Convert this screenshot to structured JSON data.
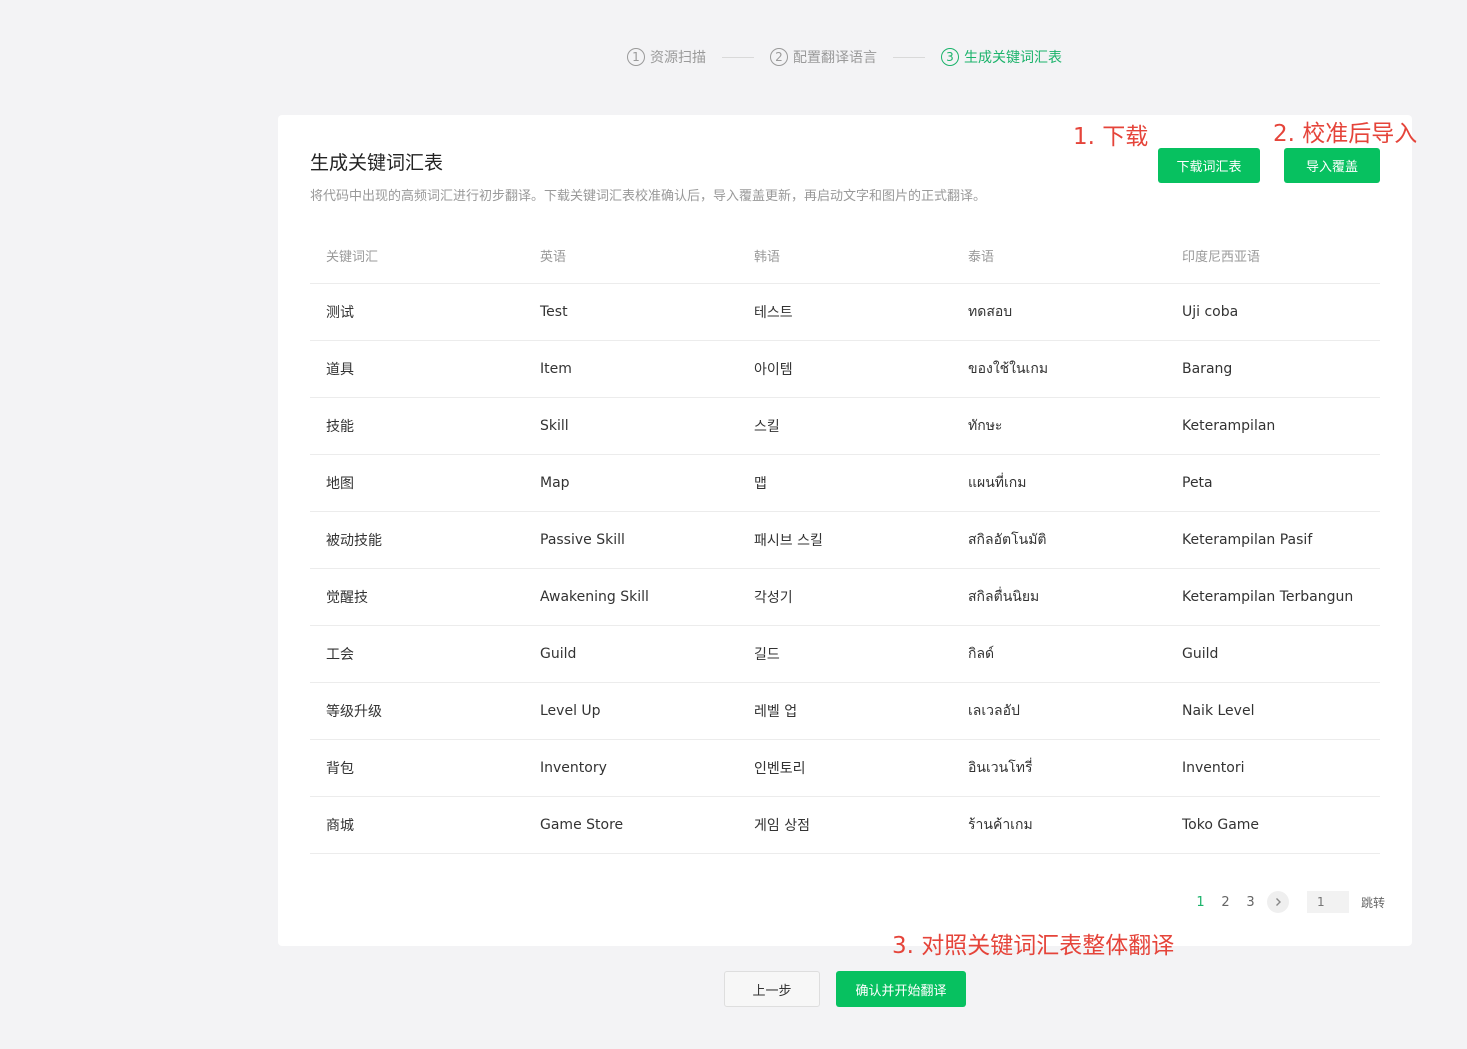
{
  "steps": [
    {
      "num": "1",
      "label": "资源扫描",
      "active": false
    },
    {
      "num": "2",
      "label": "配置翻译语言",
      "active": false
    },
    {
      "num": "3",
      "label": "生成关键词汇表",
      "active": true
    }
  ],
  "card": {
    "title": "生成关键词汇表",
    "description": "将代码中出现的高频词汇进行初步翻译。下载关键词汇表校准确认后，导入覆盖更新，再启动文字和图片的正式翻译。",
    "download_label": "下载词汇表",
    "import_label": "导入覆盖"
  },
  "annotations": {
    "a1": "1. 下载",
    "a2": "2. 校准后导入",
    "a3": "3. 对照关键词汇表整体翻译"
  },
  "table": {
    "headers": [
      "关键词汇",
      "英语",
      "韩语",
      "泰语",
      "印度尼西亚语"
    ],
    "rows": [
      [
        "测试",
        "Test",
        "테스트",
        "ทดสอบ",
        "Uji coba"
      ],
      [
        "道具",
        "Item",
        "아이템",
        "ของใช้ในเกม",
        "Barang"
      ],
      [
        "技能",
        "Skill",
        "스킬",
        "ทักษะ",
        "Keterampilan"
      ],
      [
        "地图",
        "Map",
        "맵",
        "แผนที่เกม",
        "Peta"
      ],
      [
        "被动技能",
        "Passive Skill",
        "패시브 스킬",
        "สกิลอัตโนมัติ",
        "Keterampilan Pasif"
      ],
      [
        "觉醒技",
        "Awakening Skill",
        "각성기",
        "สกิลตื่นนิยม",
        "Keterampilan Terbangun"
      ],
      [
        "工会",
        "Guild",
        "길드",
        "กิลด์",
        "Guild"
      ],
      [
        "等级升级",
        "Level Up",
        "레벨 업",
        "เลเวลอัป",
        "Naik Level"
      ],
      [
        "背包",
        "Inventory",
        "인벤토리",
        "อินเวนโทรี่",
        "Inventori"
      ],
      [
        "商城",
        "Game Store",
        "게임 상점",
        "ร้านค้าเกม",
        "Toko Game"
      ]
    ]
  },
  "pagination": {
    "pages": [
      "1",
      "2",
      "3"
    ],
    "current": "1",
    "jump_placeholder": "1",
    "jump_label": "跳转"
  },
  "footer": {
    "prev_label": "上一步",
    "confirm_label": "确认并开始翻译"
  },
  "colors": {
    "accent": "#07c160",
    "annotation": "#e5443a"
  }
}
